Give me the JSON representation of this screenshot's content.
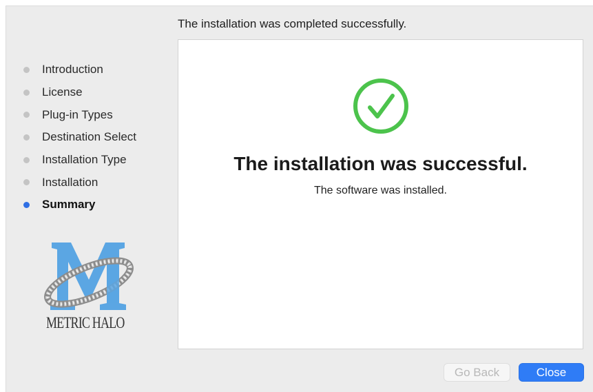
{
  "header": {
    "title": "The installation was completed successfully."
  },
  "sidebar": {
    "items": [
      {
        "label": "Introduction",
        "active": false
      },
      {
        "label": "License",
        "active": false
      },
      {
        "label": "Plug-in Types",
        "active": false
      },
      {
        "label": "Destination Select",
        "active": false
      },
      {
        "label": "Installation Type",
        "active": false
      },
      {
        "label": "Installation",
        "active": false
      },
      {
        "label": "Summary",
        "active": true
      }
    ],
    "logo": {
      "text": "METRIC HALO",
      "icon": "metric-halo-logo"
    }
  },
  "main": {
    "icon": "checkmark-circle-icon",
    "title": "The installation was successful.",
    "subtitle": "The software was installed."
  },
  "buttons": {
    "back_label": "Go Back",
    "close_label": "Close"
  },
  "colors": {
    "accent": "#2f7cf6",
    "success": "#4cc34c",
    "active_dot": "#2f6fe4",
    "inactive_dot": "#c4c4c4"
  }
}
